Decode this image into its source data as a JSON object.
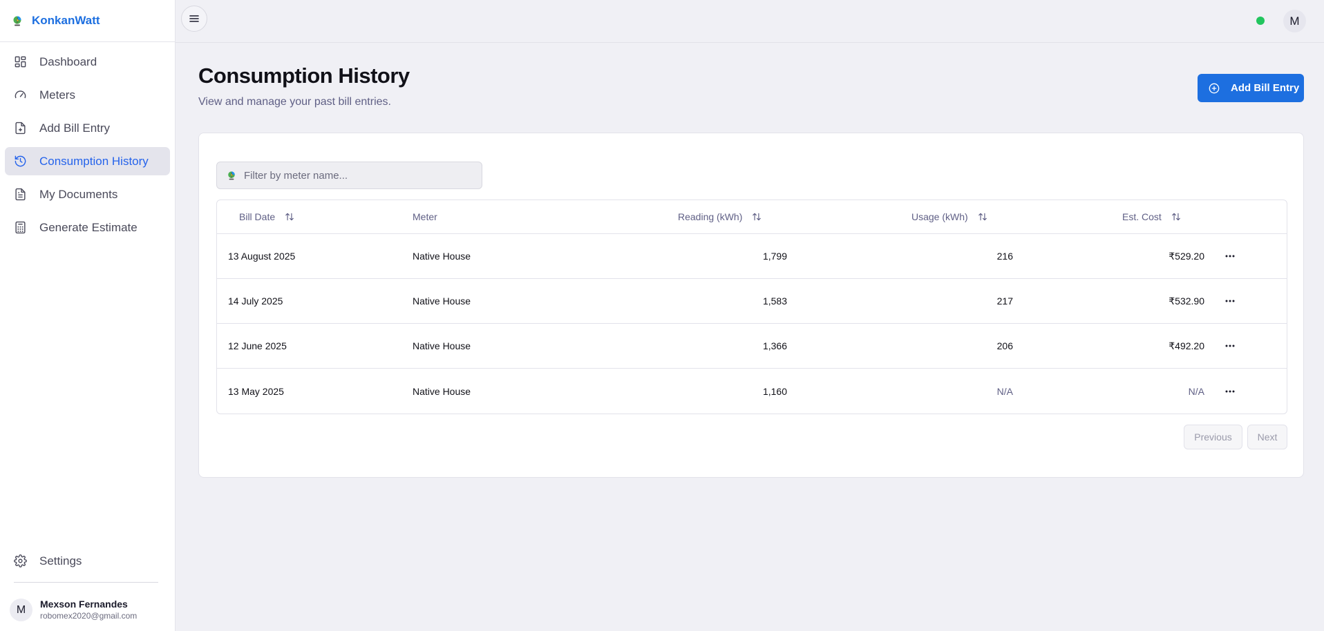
{
  "app": {
    "name": "KonkanWatt"
  },
  "sidebar": {
    "items": [
      {
        "label": "Dashboard",
        "icon": "dashboard-icon"
      },
      {
        "label": "Meters",
        "icon": "gauge-icon"
      },
      {
        "label": "Add Bill Entry",
        "icon": "file-plus-icon"
      },
      {
        "label": "Consumption History",
        "icon": "history-icon",
        "active": true
      },
      {
        "label": "My Documents",
        "icon": "document-icon"
      },
      {
        "label": "Generate Estimate",
        "icon": "calculator-icon"
      }
    ],
    "settings_label": "Settings",
    "user": {
      "initial": "M",
      "name": "Mexson Fernandes",
      "email": "robomex2020@gmail.com"
    }
  },
  "topbar": {
    "avatar_initial": "M",
    "status_color": "#22c55e"
  },
  "page": {
    "title": "Consumption History",
    "subtitle": "View and manage your past bill entries.",
    "add_button": "Add Bill Entry"
  },
  "filter": {
    "placeholder": "Filter by meter name...",
    "value": ""
  },
  "table": {
    "headers": {
      "bill_date": "Bill Date",
      "meter": "Meter",
      "reading": "Reading (kWh)",
      "usage": "Usage (kWh)",
      "cost": "Est. Cost"
    },
    "rows": [
      {
        "bill_date": "13 August 2025",
        "meter": "Native House",
        "reading": "1,799",
        "usage": "216",
        "cost": "₹529.20"
      },
      {
        "bill_date": "14 July 2025",
        "meter": "Native House",
        "reading": "1,583",
        "usage": "217",
        "cost": "₹532.90"
      },
      {
        "bill_date": "12 June 2025",
        "meter": "Native House",
        "reading": "1,366",
        "usage": "206",
        "cost": "₹492.20"
      },
      {
        "bill_date": "13 May 2025",
        "meter": "Native House",
        "reading": "1,160",
        "usage": "N/A",
        "cost": "N/A"
      }
    ]
  },
  "pagination": {
    "previous": "Previous",
    "next": "Next"
  },
  "colors": {
    "accent": "#1d6fe0",
    "active_bg": "#e4e4ec",
    "muted_text": "#5f5f85"
  }
}
